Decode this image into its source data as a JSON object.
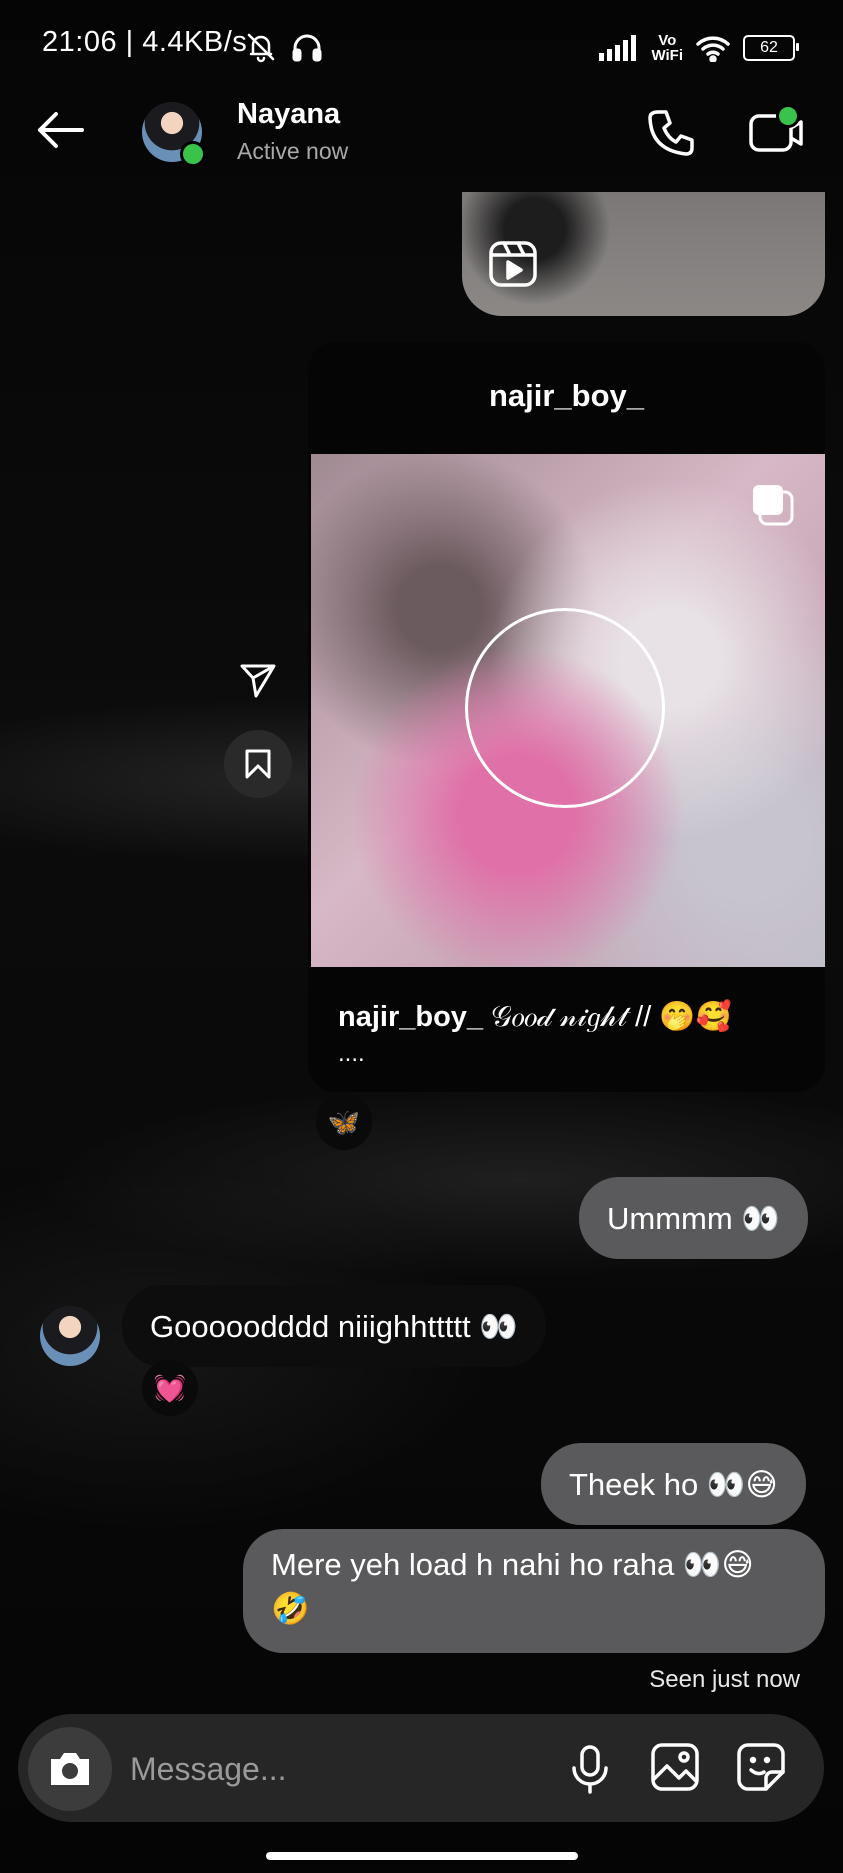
{
  "status_bar": {
    "time": "21:06 | 4.4KB/s",
    "vowifi": "Vo\nWiFi",
    "battery": "62"
  },
  "header": {
    "contact_name": "Nayana",
    "contact_status": "Active now"
  },
  "shared_post": {
    "author": "najir_boy_",
    "caption_user": "najir_boy_",
    "caption_text": "𝒢𝑜𝑜𝒹 𝓃𝒾𝑔𝒽𝓉 // 🤭🥰",
    "caption_more": "....",
    "reaction": "🦋"
  },
  "messages": [
    {
      "from": "me",
      "text": "Ummmm 👀"
    },
    {
      "from": "them",
      "text": "Gooooodddd niiighhttttt 👀",
      "reaction": "💓"
    },
    {
      "from": "me",
      "text": "Theek ho 👀😅"
    },
    {
      "from": "me",
      "text": "Mere yeh load h nahi ho raha 👀😅 🤣"
    }
  ],
  "seen_status": "Seen just now",
  "composer": {
    "placeholder": "Message..."
  },
  "icons": {
    "back": "back-arrow-icon",
    "call": "phone-icon",
    "video": "video-call-icon",
    "share": "send-icon",
    "save": "bookmark-icon",
    "camera": "camera-icon",
    "mic": "microphone-icon",
    "gallery": "gallery-icon",
    "sticker": "sticker-icon"
  },
  "colors": {
    "online": "#3ac34a",
    "my_bubble": "#5a5a5c",
    "composer": "#262626"
  }
}
